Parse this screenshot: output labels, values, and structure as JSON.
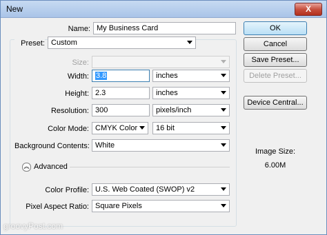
{
  "window": {
    "title": "New",
    "close_symbol": "X"
  },
  "form": {
    "name_label": "Name:",
    "name_value": "My Business Card",
    "preset_label": "Preset:",
    "preset_value": "Custom",
    "size_label": "Size:",
    "size_value": "",
    "width_label": "Width:",
    "width_value": "3.8",
    "width_unit": "inches",
    "height_label": "Height:",
    "height_value": "2.3",
    "height_unit": "inches",
    "resolution_label": "Resolution:",
    "resolution_value": "300",
    "resolution_unit": "pixels/inch",
    "color_mode_label": "Color Mode:",
    "color_mode_value": "CMYK Color",
    "bit_depth_value": "16 bit",
    "background_label": "Background Contents:",
    "background_value": "White",
    "advanced_label": "Advanced",
    "color_profile_label": "Color Profile:",
    "color_profile_value": "U.S. Web Coated (SWOP) v2",
    "pixel_aspect_label": "Pixel Aspect Ratio:",
    "pixel_aspect_value": "Square Pixels"
  },
  "buttons": {
    "ok": "OK",
    "cancel": "Cancel",
    "save_preset": "Save Preset...",
    "delete_preset": "Delete Preset...",
    "device_central": "Device Central..."
  },
  "info": {
    "image_size_label": "Image Size:",
    "image_size_value": "6.00M"
  },
  "watermark": "groovyPost.com",
  "colors": {
    "accent": "#3399ff",
    "titlebar": "#b7cfee",
    "close": "#c7503f"
  }
}
